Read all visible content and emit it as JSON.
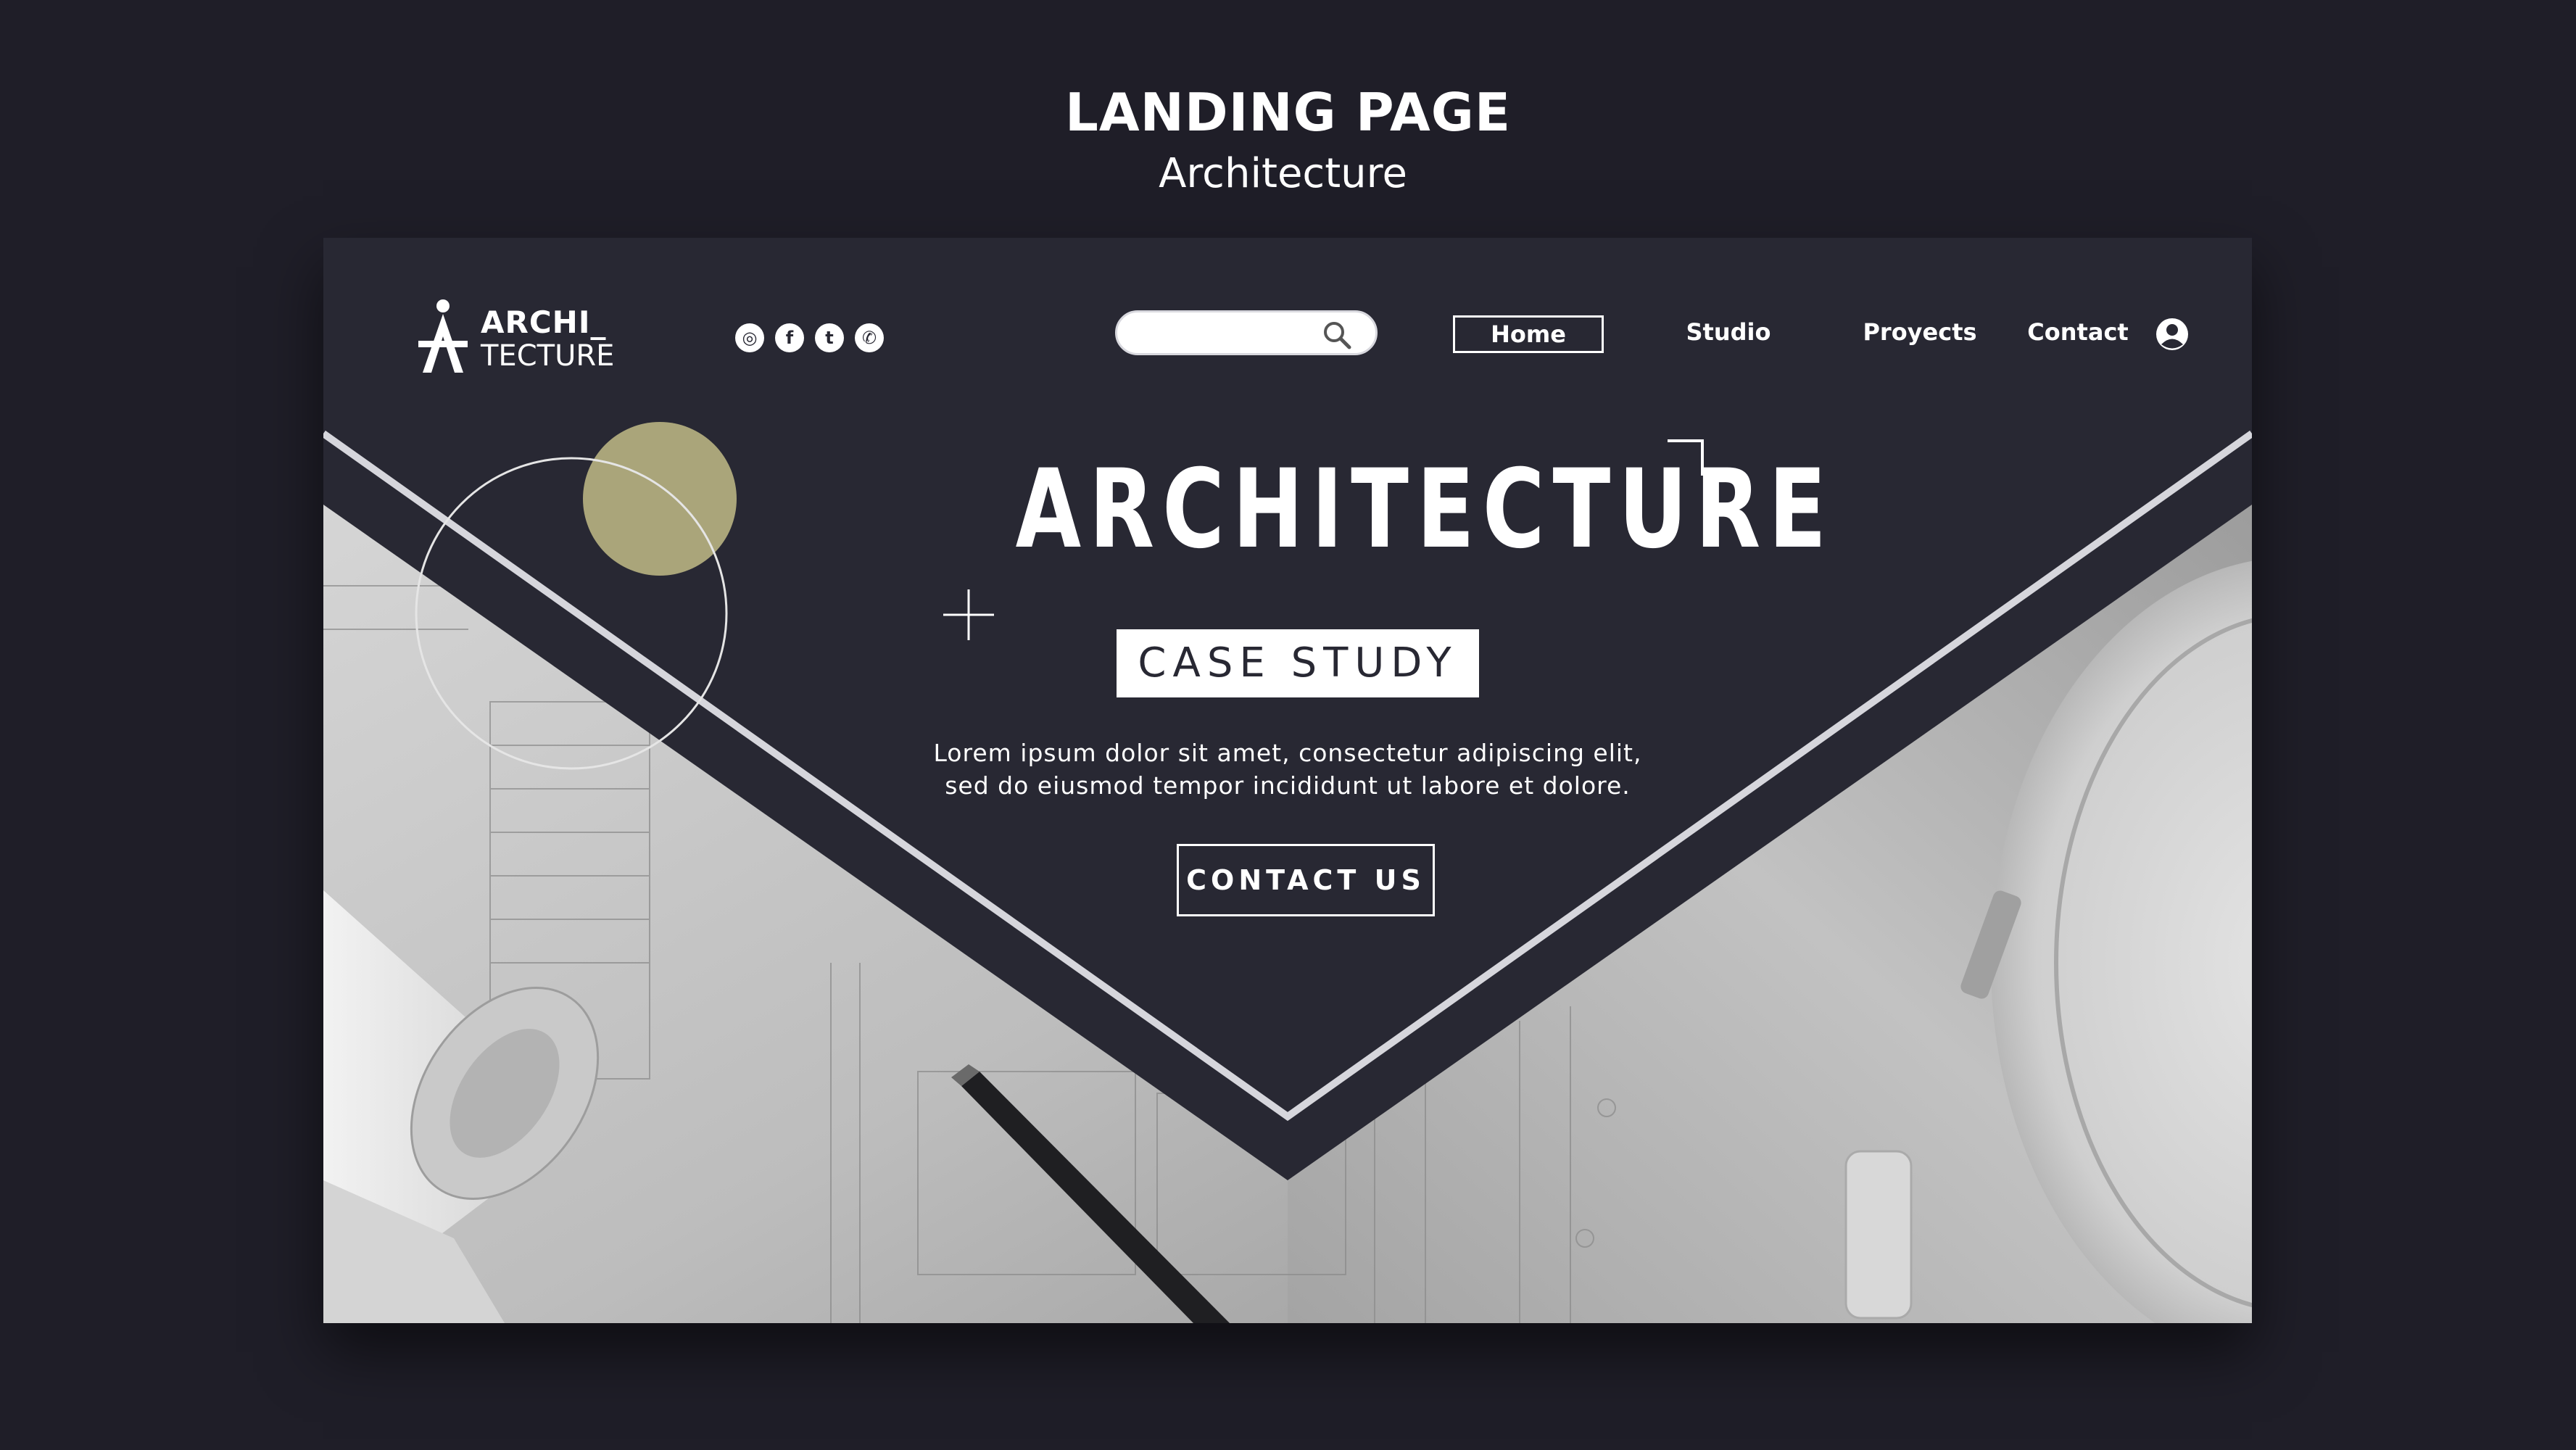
{
  "page": {
    "title": "LANDING PAGE",
    "subtitle": "Architecture"
  },
  "nav": {
    "logo_line1": "ARCHI_",
    "logo_line2": "TECTURE",
    "socials": [
      {
        "icon": "instagram-icon",
        "glyph": "◎"
      },
      {
        "icon": "facebook-icon",
        "glyph": "f"
      },
      {
        "icon": "twitter-icon",
        "glyph": "t"
      },
      {
        "icon": "whatsapp-icon",
        "glyph": "✆"
      }
    ],
    "search_value": "",
    "items": [
      "Home",
      "Studio",
      "Proyects",
      "Contact"
    ],
    "active_item": "Home"
  },
  "hero": {
    "title": "ARCHITECTURE",
    "badge": "CASE STUDY",
    "text_line1": "Lorem ipsum dolor sit amet, consectetur adipiscing elit,",
    "text_line2": "sed do eiusmod tempor incididunt ut labore et dolore.",
    "button": "CONTACT US"
  },
  "colors": {
    "background": "#1f1e28",
    "panel": "#282833",
    "accent": "#aaa57a",
    "white": "#ffffff"
  }
}
